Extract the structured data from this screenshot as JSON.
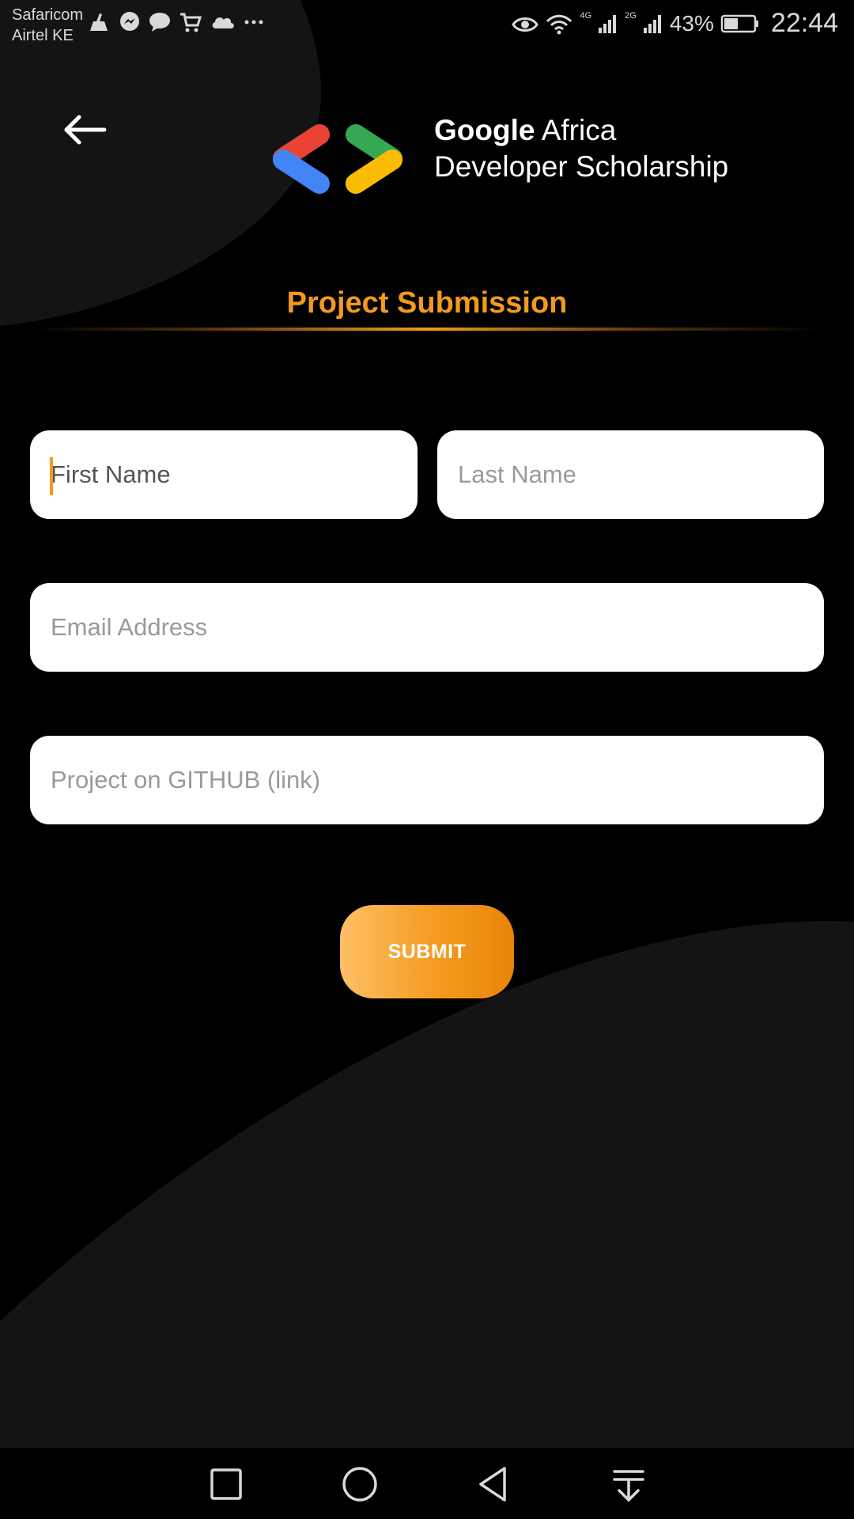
{
  "status_bar": {
    "carrier_1": "Safaricom",
    "carrier_2": "Airtel KE",
    "notification_icons": [
      "cleaner-icon",
      "messenger-icon",
      "chat-icon",
      "cart-icon",
      "cloud-icon",
      "more-icon"
    ],
    "network_1": "4G",
    "network_2": "2G",
    "battery_percent": "43%",
    "time": "22:44"
  },
  "header": {
    "brand_line_1_bold": "Google",
    "brand_line_1_rest": "Africa",
    "brand_line_2": "Developer Scholarship"
  },
  "page": {
    "title": "Project Submission"
  },
  "form": {
    "first_name": {
      "value": "",
      "placeholder": "First Name"
    },
    "last_name": {
      "value": "",
      "placeholder": "Last Name"
    },
    "email": {
      "value": "",
      "placeholder": "Email Address"
    },
    "github_link": {
      "value": "",
      "placeholder": "Project on GITHUB (link)"
    },
    "submit_label": "SUBMIT"
  },
  "colors": {
    "accent": "#f39a1c",
    "background": "#000000",
    "blob": "#141414",
    "logo_red": "#ea4335",
    "logo_blue": "#4285f4",
    "logo_green": "#34a853",
    "logo_yellow": "#fbbc04"
  },
  "nav_bar": {
    "buttons": [
      "recents-square-icon",
      "home-circle-icon",
      "back-triangle-icon",
      "notification-pulldown-icon"
    ]
  }
}
